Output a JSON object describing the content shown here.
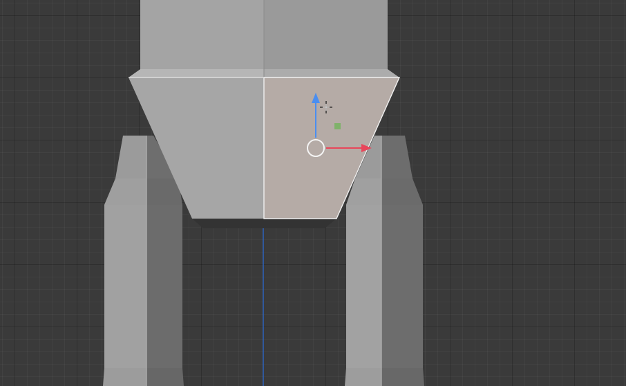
{
  "app": {
    "view": "3d-viewport",
    "mode": "edit-mode-face-select"
  },
  "colors": {
    "grid_background": "#3a3a3a",
    "face_light": "#a5a5a5",
    "face_mid": "#8e8e8e",
    "face_dark": "#6a6a6a",
    "face_selected": "#b4aaa5",
    "edge_selected": "#f0f0f0",
    "axis_z": "#2f6fd6",
    "gizmo_x": "#e8465a",
    "gizmo_z": "#4a8ef0",
    "face_center_dot": "#7fb26a"
  },
  "gizmo": {
    "type": "move-gizmo",
    "axes": [
      "x",
      "z"
    ]
  },
  "icons": {
    "cursor": "crosshair-icon",
    "pivot": "pivot-circle-icon",
    "face_dot": "face-center-dot-icon"
  }
}
